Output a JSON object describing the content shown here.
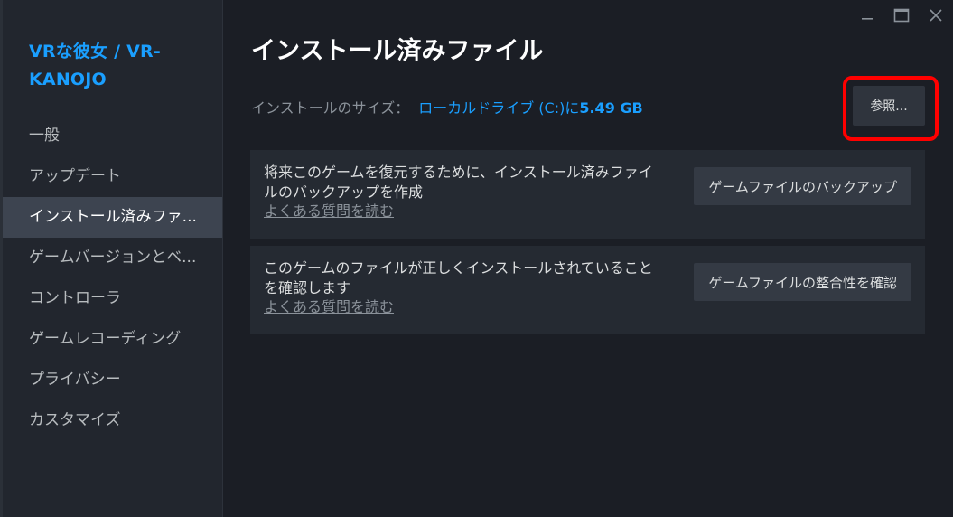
{
  "sidebar": {
    "game_title": "VRな彼女 / VR-KANOJO",
    "items": [
      {
        "label": "一般"
      },
      {
        "label": "アップデート"
      },
      {
        "label": "インストール済みファ..."
      },
      {
        "label": "ゲームバージョンとベ..."
      },
      {
        "label": "コントローラ"
      },
      {
        "label": "ゲームレコーディング"
      },
      {
        "label": "プライバシー"
      },
      {
        "label": "カスタマイズ"
      }
    ],
    "active_index": 2
  },
  "window": {
    "minimize_icon": "minimize-icon",
    "maximize_icon": "maximize-icon",
    "close_icon": "close-icon"
  },
  "main": {
    "title": "インストール済みファイル",
    "size_label": "インストールのサイズ：",
    "size_drive": "ローカルドライブ (C:)に",
    "size_value": "5.49 GB",
    "browse_button": "参照...",
    "backup": {
      "description": "将来このゲームを復元するために、インストール済みファイルのバックアップを作成",
      "faq_link": "よくある質問を読む",
      "button": "ゲームファイルのバックアップ"
    },
    "verify": {
      "description": "このゲームのファイルが正しくインストールされていることを確認します",
      "faq_link": "よくある質問を読む",
      "button": "ゲームファイルの整合性を確認"
    }
  },
  "colors": {
    "accent": "#1a9fff",
    "highlight": "#ff0000",
    "background": "#1b1e25",
    "sidebar": "#22262e"
  }
}
